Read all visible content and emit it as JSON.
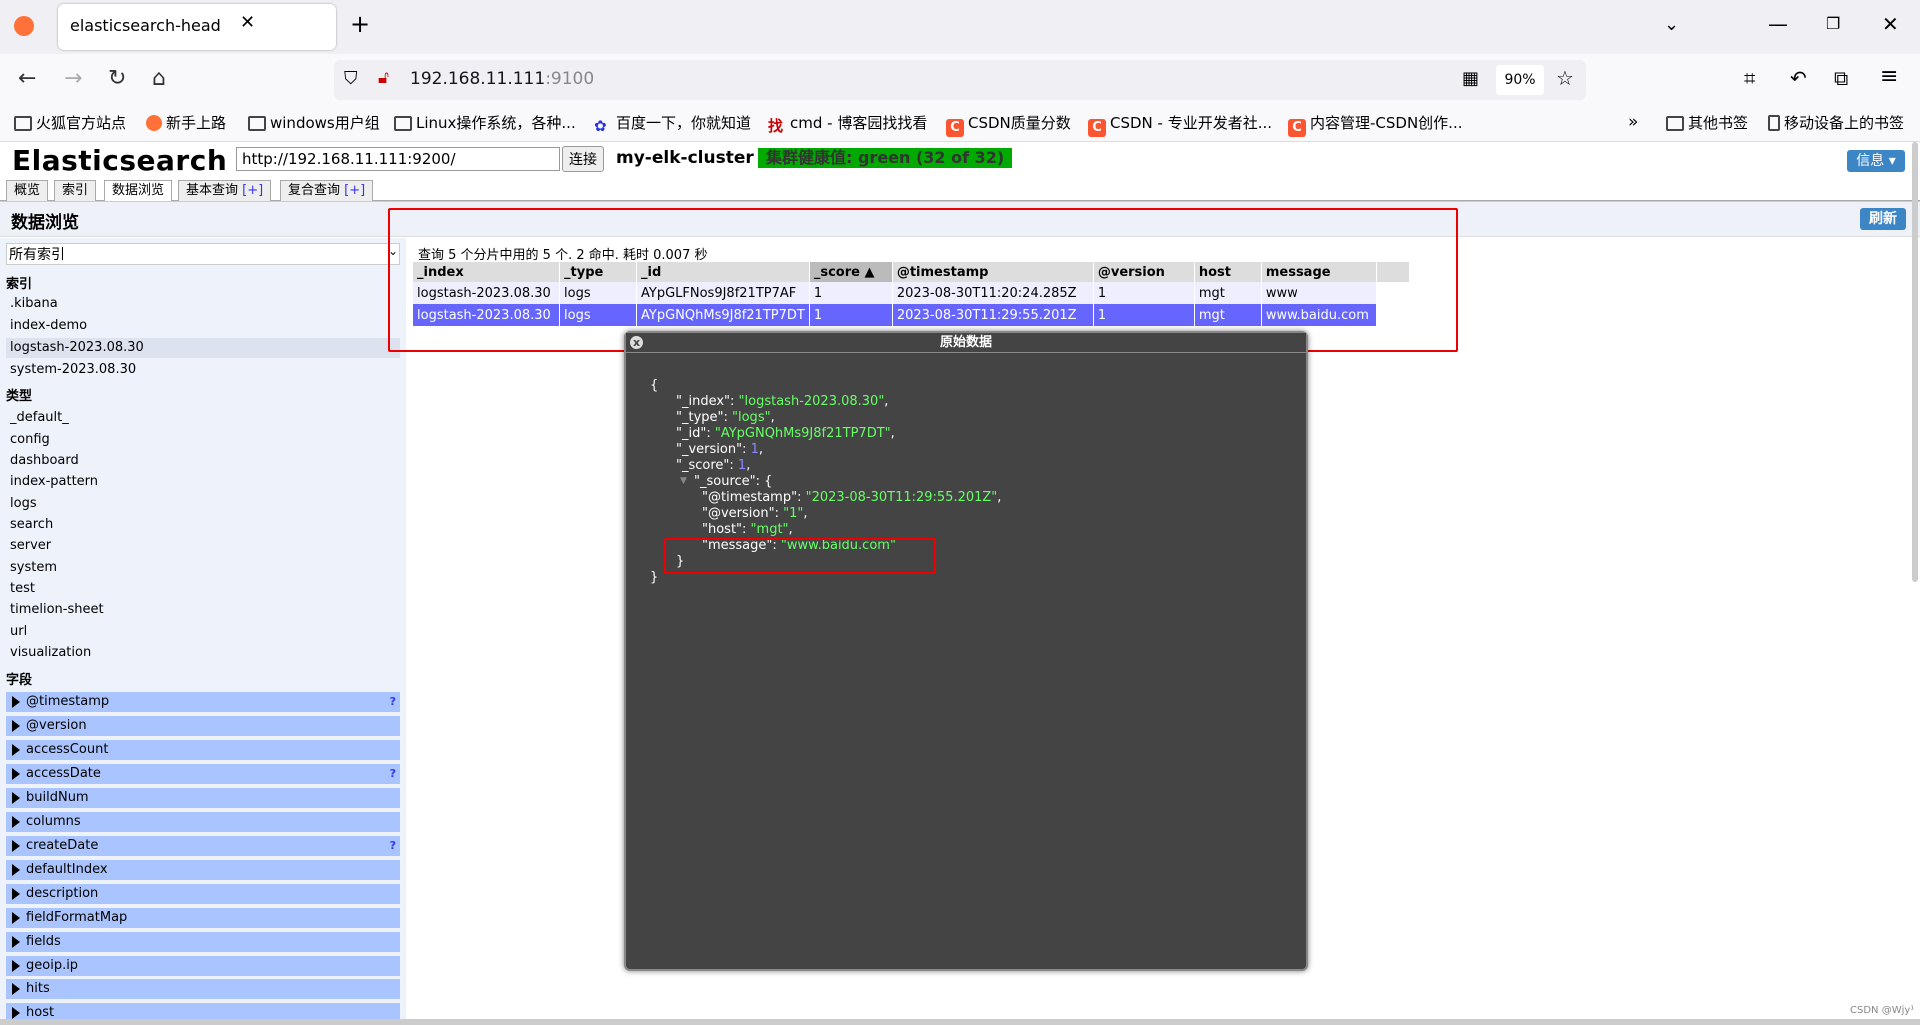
{
  "browser": {
    "tab_title": "elasticsearch-head",
    "url_host": "192.168.11.111",
    "url_port": ":9100",
    "zoom": "90%",
    "bookmarks": [
      "火狐官方站点",
      "新手上路",
      "windows用户组",
      "Linux操作系统，各种...",
      "百度一下，你就知道",
      "cmd - 博客园找找看",
      "CSDN质量分数",
      "CSDN - 专业开发者社...",
      "内容管理-CSDN创作...",
      "其他书签",
      "移动设备上的书签"
    ]
  },
  "app": {
    "brand": "Elasticsearch",
    "connect_url": "http://192.168.11.111:9200/",
    "connect_label": "连接",
    "cluster_name": "my-elk-cluster",
    "health": "集群健康值: green (32 of 32)",
    "info_label": "信息 ▾",
    "tabs": [
      "概览",
      "索引",
      "数据浏览",
      "基本查询",
      "复合查询"
    ],
    "plus": "[+]",
    "section_title": "数据浏览",
    "refresh_label": "刷新"
  },
  "sidebar": {
    "index_select": "所有索引",
    "indices_head": "索引",
    "indices": [
      ".kibana",
      "index-demo",
      "logstash-2023.08.30",
      "system-2023.08.30"
    ],
    "types_head": "类型",
    "types": [
      "_default_",
      "config",
      "dashboard",
      "index-pattern",
      "logs",
      "search",
      "server",
      "system",
      "test",
      "timelion-sheet",
      "url",
      "visualization"
    ],
    "fields_head": "字段",
    "fields": [
      "@timestamp",
      "@version",
      "accessCount",
      "accessDate",
      "buildNum",
      "columns",
      "createDate",
      "defaultIndex",
      "description",
      "fieldFormatMap",
      "fields",
      "geoip.ip",
      "hits",
      "host"
    ],
    "question_mark": "?"
  },
  "results": {
    "summary": "查询 5 个分片中用的 5 个. 2 命中. 耗时 0.007 秒",
    "columns": [
      "_index",
      "_type",
      "_id",
      "_score ▲",
      "@timestamp",
      "@version",
      "host",
      "message"
    ],
    "rows": [
      [
        "logstash-2023.08.30",
        "logs",
        "AYpGLFNos9J8f21TP7AF",
        "1",
        "2023-08-30T11:20:24.285Z",
        "1",
        "mgt",
        "www"
      ],
      [
        "logstash-2023.08.30",
        "logs",
        "AYpGNQhMs9J8f21TP7DT",
        "1",
        "2023-08-30T11:29:55.201Z",
        "1",
        "mgt",
        "www.baidu.com"
      ]
    ]
  },
  "dialog": {
    "title": "原始数据",
    "close": "x",
    "json": {
      "open": "{",
      "index_key": "\"_index\": ",
      "index_val": "\"logstash-2023.08.30\"",
      "type_key": "\"_type\": ",
      "type_val": "\"logs\"",
      "id_key": "\"_id\": ",
      "id_val": "\"AYpGNQhMs9J8f21TP7DT\"",
      "version_key": "\"_version\": ",
      "version_val": "1",
      "score_key": "\"_score\": ",
      "score_val": "1",
      "source_key": "\"_source\": {",
      "ts_key": "\"@timestamp\": ",
      "ts_val": "\"2023-08-30T11:29:55.201Z\"",
      "ver_key": "\"@version\": ",
      "ver_val": "\"1\"",
      "host_key": "\"host\": ",
      "host_val": "\"mgt\"",
      "msg_key": "\"message\": ",
      "msg_val": "\"www.baidu.com\"",
      "close_inner": "}",
      "close_outer": "}"
    }
  },
  "watermark": "CSDN @Wjy¹"
}
